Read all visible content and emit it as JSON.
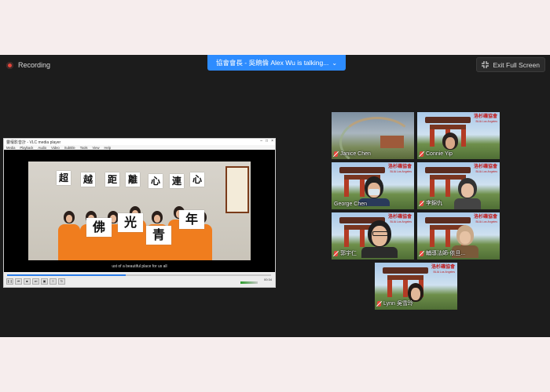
{
  "top_bar": {
    "recording_label": "Recording",
    "talking_banner": "協會會長 - 吳餉倫 Alex Wu is talking...",
    "exit_full_screen": "Exit Full Screen"
  },
  "player": {
    "title": "靈壇影音計 - VLC media player",
    "menu": [
      "Media",
      "Playback",
      "Audio",
      "Video",
      "Subtitle",
      "Tools",
      "View",
      "Help"
    ],
    "signs_top": [
      "超",
      "越",
      "距",
      "離",
      "心",
      "連",
      "心"
    ],
    "signs_bottom": [
      "佛",
      "光",
      "青",
      "年"
    ],
    "subtitle": "ust of a beautiful place for us all",
    "time": "00:34",
    "progress": 0.45
  },
  "participants": [
    {
      "name": "Janice Chen",
      "muted": true
    },
    {
      "name": "Connie Yip",
      "muted": true
    },
    {
      "name": "George Chen",
      "muted": false
    },
    {
      "name": "李錦仇",
      "muted": true
    },
    {
      "name": "郭宇仁",
      "muted": true
    },
    {
      "name": "輔導法師-依旦...",
      "muted": true
    },
    {
      "name": "Lynn 吳雪玲",
      "muted": true
    }
  ],
  "logo": {
    "zh": "洛杉磯協會",
    "en": "BLIA Los Angeles"
  },
  "colors": {
    "accent_blue": "#2d8cff",
    "recording_red": "#e5453a",
    "shirt_orange": "#f07d1e",
    "zoom_background": "#1c1c1c"
  }
}
